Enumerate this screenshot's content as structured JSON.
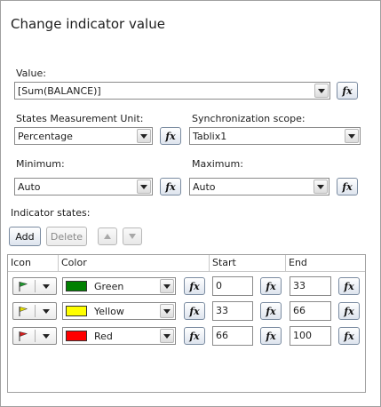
{
  "dialog": {
    "title": "Change indicator value"
  },
  "value": {
    "label": "Value:",
    "selected": "[Sum(BALANCE)]",
    "fx_label": "fx"
  },
  "states_unit": {
    "label": "States Measurement Unit:",
    "selected": "Percentage",
    "fx_label": "fx"
  },
  "sync_scope": {
    "label": "Synchronization scope:",
    "selected": "Tablix1"
  },
  "minimum": {
    "label": "Minimum:",
    "selected": "Auto",
    "fx_label": "fx"
  },
  "maximum": {
    "label": "Maximum:",
    "selected": "Auto",
    "fx_label": "fx"
  },
  "indicator_states": {
    "label": "Indicator states:",
    "add_label": "Add",
    "delete_label": "Delete",
    "columns": [
      "Icon",
      "Color",
      "Start",
      "End"
    ],
    "rows": [
      {
        "icon": "green-flag-icon",
        "flag_color": "#1e9b2e",
        "color_name": "Green",
        "swatch": "#008000",
        "start": "0",
        "end": "33",
        "fx_label": "fx"
      },
      {
        "icon": "yellow-flag-icon",
        "flag_color": "#e6e000",
        "color_name": "Yellow",
        "swatch": "#ffff00",
        "start": "33",
        "end": "66",
        "fx_label": "fx"
      },
      {
        "icon": "red-flag-icon",
        "flag_color": "#d81e1e",
        "color_name": "Red",
        "swatch": "#ff0000",
        "start": "66",
        "end": "100",
        "fx_label": "fx"
      }
    ]
  }
}
